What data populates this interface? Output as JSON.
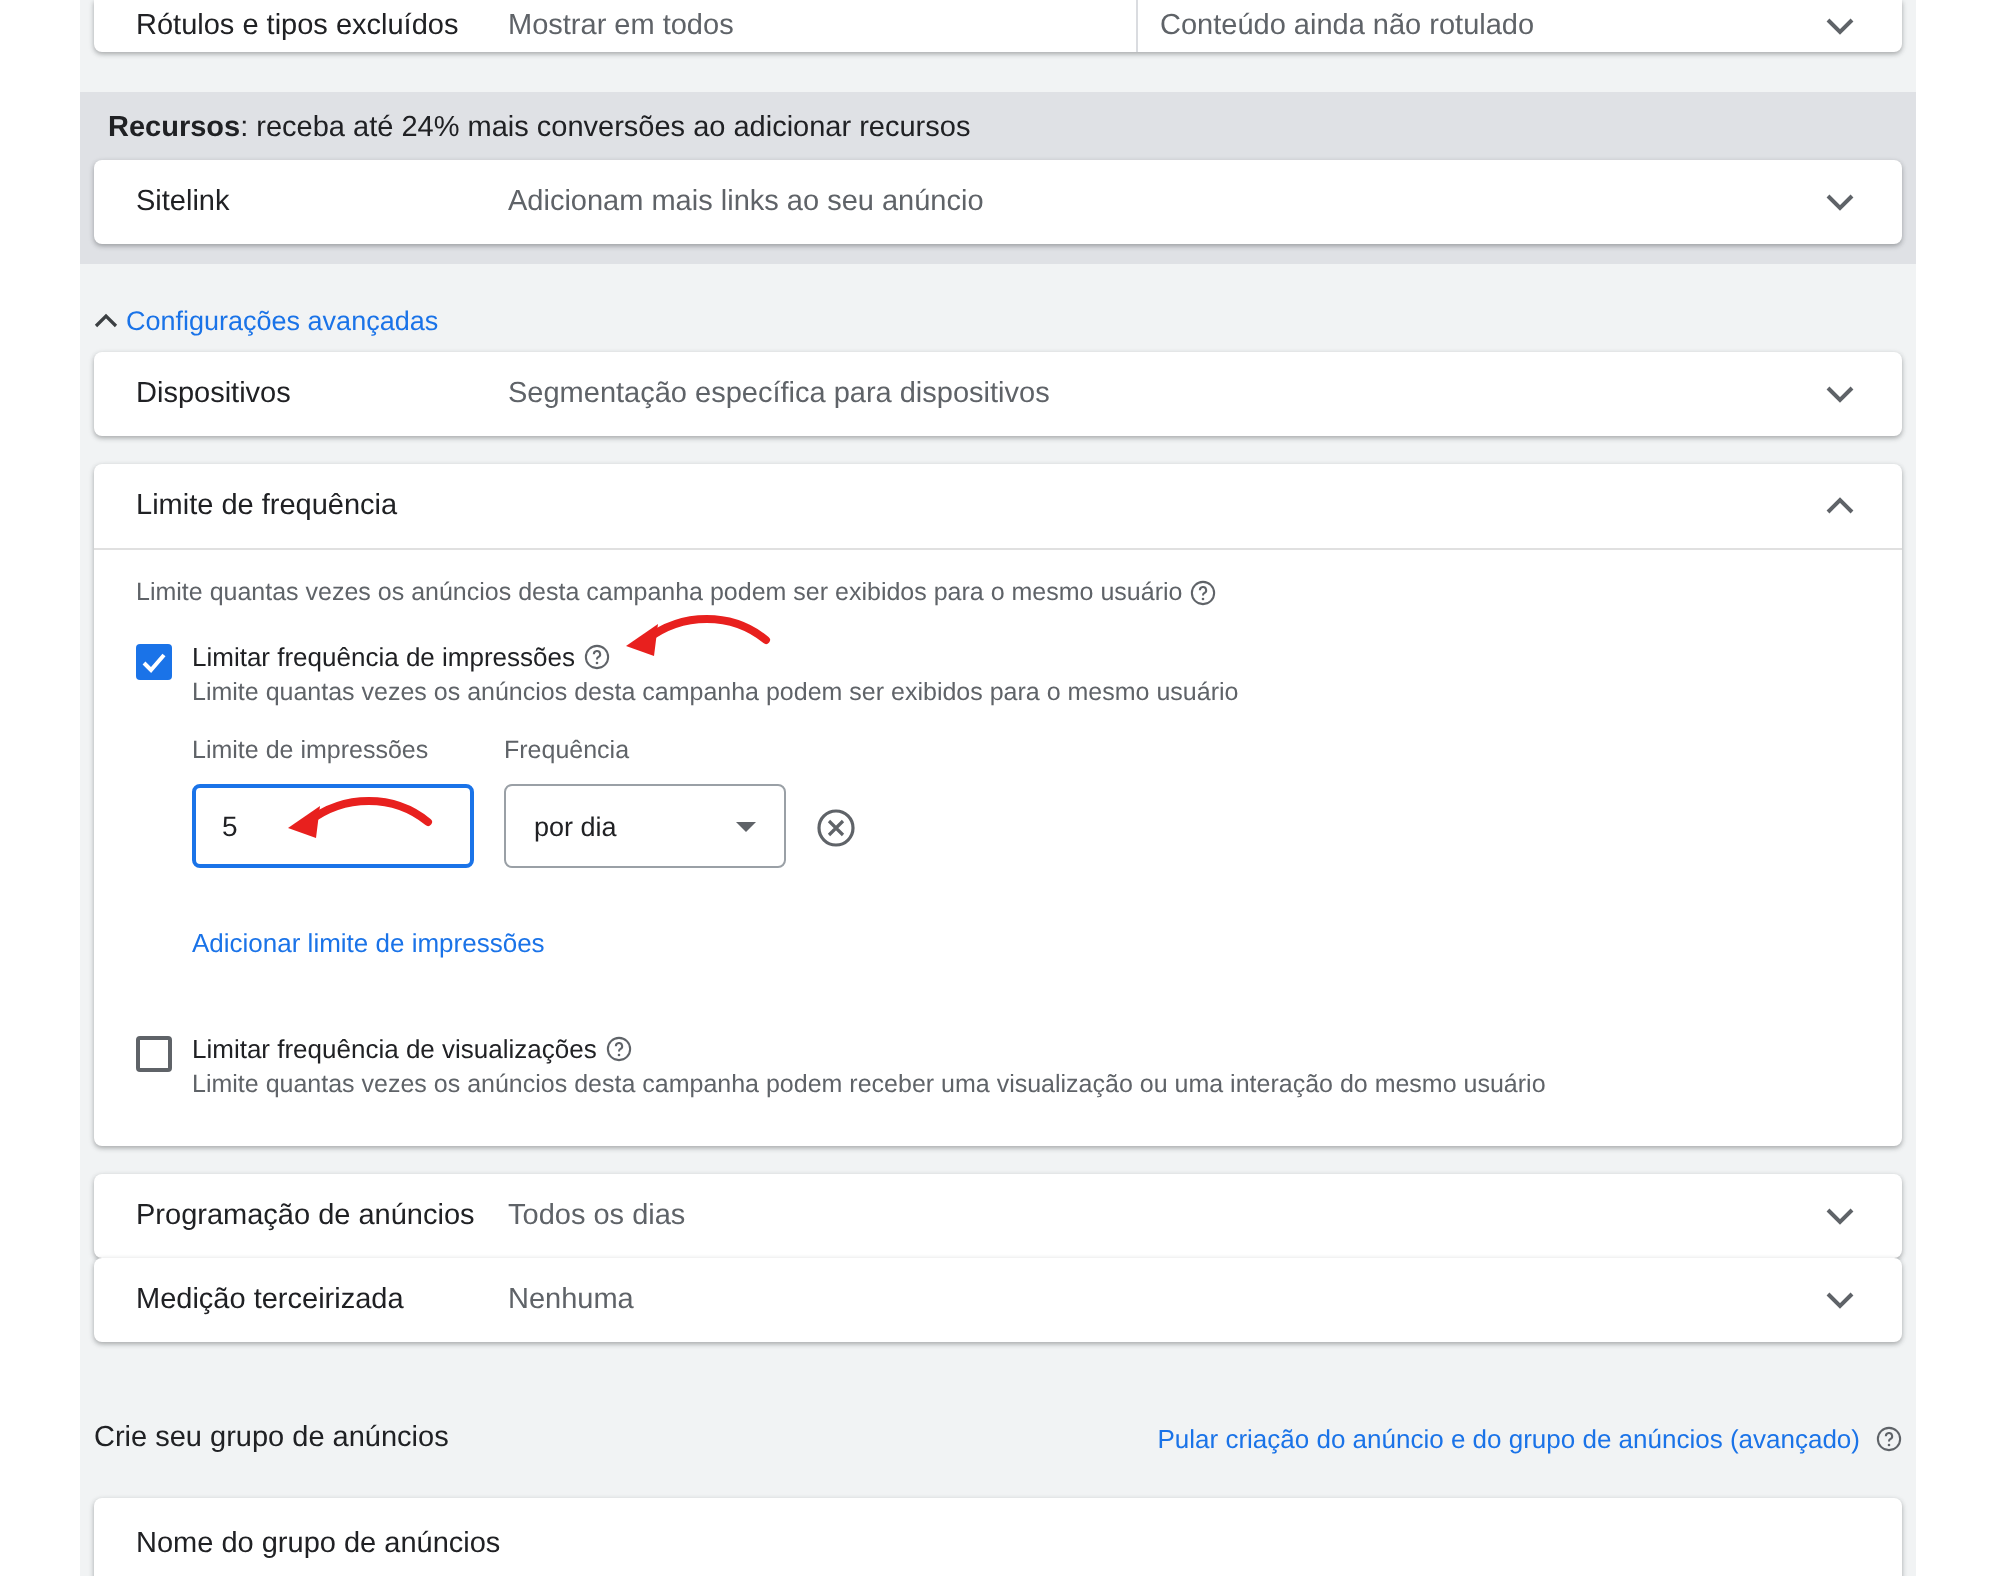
{
  "top_row": {
    "label": "Rótulos e tipos excluídos",
    "value": "Mostrar em todos",
    "value_2": "Conteúdo ainda não rotulado",
    "expanded": false
  },
  "resources": {
    "heading": "**Recursos**: receba até 24% mais conversões ao adicionar recursos",
    "rows": [
      {
        "label": "Sitelink",
        "value": "Adicionam mais links ao seu anúncio",
        "expanded": false
      }
    ]
  },
  "advanced_toggle": {
    "label": "Configurações avançadas",
    "expanded": true
  },
  "sections": [
    {
      "kind": "row",
      "label": "Dispositivos",
      "value": "Segmentação específica para dispositivos",
      "expanded": false
    },
    {
      "kind": "frequency",
      "label": "Limite de frequência",
      "expanded": true,
      "description": "Limite quantas vezes os anúncios desta campanha podem ser exibidos para o mesmo usuário",
      "options": [
        {
          "label": "Limitar frequência de impressões",
          "checked": true,
          "description": "Limite quantas vezes os anúncios desta campanha podem ser exibidos para o mesmo usuário",
          "limit_label": "Limite de impressões",
          "limit_value": "5",
          "frequency_label": "Frequência",
          "frequency_value": "por dia",
          "add_link": "Adicionar limite de impressões"
        },
        {
          "label": "Limitar frequência de visualizações",
          "checked": false,
          "description": "Limite quantas vezes os anúncios desta campanha podem receber uma visualização ou uma interação do mesmo usuário"
        }
      ]
    },
    {
      "kind": "row",
      "label": "Programação de anúncios",
      "value": "Todos os dias",
      "expanded": false
    },
    {
      "kind": "row",
      "label": "Medição terceirizada",
      "value": "Nenhuma",
      "expanded": false
    }
  ],
  "ad_group": {
    "title": "Crie seu grupo de anúncios",
    "skip_link": "Pular criação do anúncio e do grupo de anúncios (avançado)",
    "name_label": "Nome do grupo de anúncios"
  }
}
